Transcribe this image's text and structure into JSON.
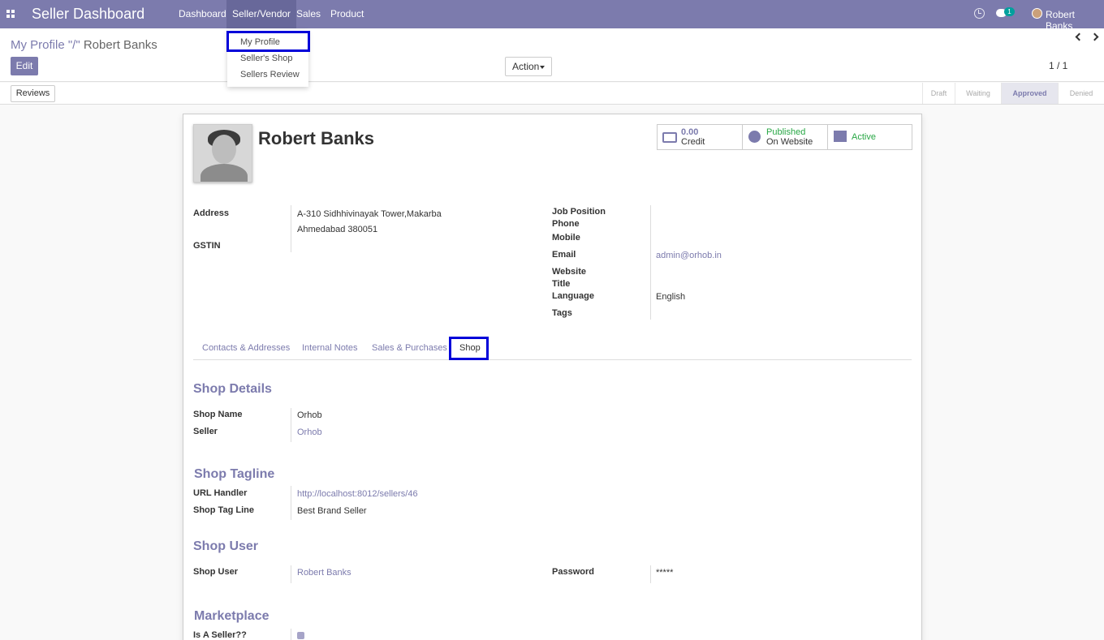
{
  "topbar": {
    "brand": "Seller Dashboard",
    "menu": [
      "Dashboard",
      "Seller/Vendor",
      "Sales",
      "Product"
    ],
    "active_menu": "Seller/Vendor",
    "chat_badge": "1",
    "user_name": "Robert Banks"
  },
  "dropdown": {
    "items": [
      "My Profile",
      "Seller's Shop",
      "Sellers Review"
    ],
    "highlighted": "My Profile"
  },
  "control_panel": {
    "breadcrumb_parent": "My Profile \"/\"",
    "breadcrumb_current": "Robert Banks",
    "edit_label": "Edit",
    "action_label": "Action",
    "pager": "1 / 1"
  },
  "statusbar": {
    "reviews_label": "Reviews",
    "stages": [
      "Draft",
      "Waiting",
      "Approved",
      "Denied"
    ],
    "current_stage": "Approved"
  },
  "profile": {
    "name": "Robert Banks",
    "stat_buttons": {
      "credit": {
        "value": "0.00",
        "label": "Credit"
      },
      "website": {
        "value": "Published",
        "label": "On Website"
      },
      "active": {
        "label": "Active"
      }
    },
    "left_fields": {
      "address_label": "Address",
      "address_line1": "A-310 Sidhhivinayak Tower,Makarba",
      "address_line2": "Ahmedabad  380051",
      "gstin_label": "GSTIN"
    },
    "right_fields": {
      "job_position_label": "Job Position",
      "phone_label": "Phone",
      "mobile_label": "Mobile",
      "email_label": "Email",
      "email_value": "admin@orhob.in",
      "website_label": "Website",
      "title_label": "Title",
      "language_label": "Language",
      "language_value": "English",
      "tags_label": "Tags"
    }
  },
  "tabs": [
    "Contacts & Addresses",
    "Internal Notes",
    "Sales & Purchases",
    "Shop"
  ],
  "active_tab": "Shop",
  "shop_details": {
    "title": "Shop Details",
    "shop_name_label": "Shop Name",
    "shop_name_value": "Orhob",
    "seller_label": "Seller",
    "seller_value": "Orhob"
  },
  "shop_tagline": {
    "title": "Shop Tagline",
    "url_label": "URL Handler",
    "url_value": "http://localhost:8012/sellers/46",
    "tagline_label": "Shop Tag Line",
    "tagline_value": "Best Brand Seller"
  },
  "shop_user": {
    "title": "Shop User",
    "user_label": "Shop User",
    "user_value": "Robert Banks",
    "password_label": "Password",
    "password_value": "*****"
  },
  "marketplace": {
    "title": "Marketplace",
    "is_seller_label": "Is A Seller??",
    "is_seller_checked": true
  },
  "colors": {
    "brand": "#7c7bad",
    "highlight": "#0000d9",
    "success": "#28a745"
  }
}
